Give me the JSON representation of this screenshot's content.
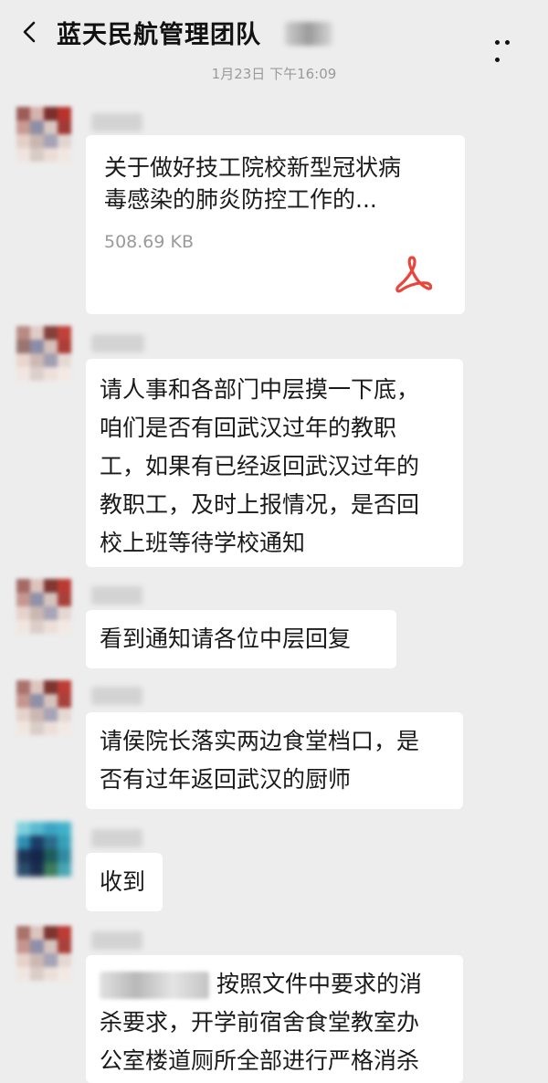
{
  "header": {
    "title": "蓝天民航管理团队"
  },
  "timestamp": "1月23日 下午16:09",
  "messages": [
    {
      "file_title_line1": "关于做好技工院校新型冠状病",
      "file_title_line2": "毒感染的肺炎防控工作的...",
      "file_size": "508.69 KB"
    },
    {
      "lines": [
        "请人事和各部门中层摸一下底，",
        "咱们是否有回武汉过年的教职",
        "工，如果有已经返回武汉过年的",
        "教职工，及时上报情况，是否回",
        "校上班等待学校通知"
      ]
    },
    {
      "lines": [
        "看到通知请各位中层回复"
      ]
    },
    {
      "lines": [
        "请侯院长落实两边食堂档口，是",
        "否有过年返回武汉的厨师"
      ]
    },
    {
      "lines": [
        "收到"
      ]
    },
    {
      "lines": [
        "按照文件中要求的消",
        "杀要求，开学前宿舍食堂教室办",
        "公室楼道厕所全部进行严格消杀"
      ]
    }
  ],
  "icons": {
    "back": "back-icon",
    "more": "more-icon",
    "pdf": "pdf-icon"
  },
  "colors": {
    "background": "#ededed",
    "bubble": "#ffffff",
    "pdf": "#e8463a",
    "muted": "#9a9a9a"
  }
}
